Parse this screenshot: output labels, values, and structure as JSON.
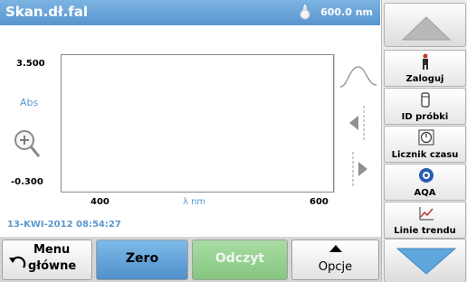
{
  "header": {
    "title": "Skan.dł.fal",
    "wavelength": "600.0 nm"
  },
  "graph": {
    "y_max": "3.500",
    "y_min": "-0.300",
    "y_unit": "Abs",
    "x_min": "400",
    "x_max": "600",
    "x_unit": "λ nm"
  },
  "status": {
    "datetime": "13-KWI-2012  08:54:27"
  },
  "right_panel": {
    "login": "Zaloguj",
    "sample_id": "ID próbki",
    "timer": "Licznik czasu",
    "aqa": "AQA",
    "trend": "Linie trendu"
  },
  "bottom_bar": {
    "menu_line1": "Menu",
    "menu_line2": "główne",
    "zero": "Zero",
    "read": "Odczyt",
    "options": "Opcje"
  }
}
